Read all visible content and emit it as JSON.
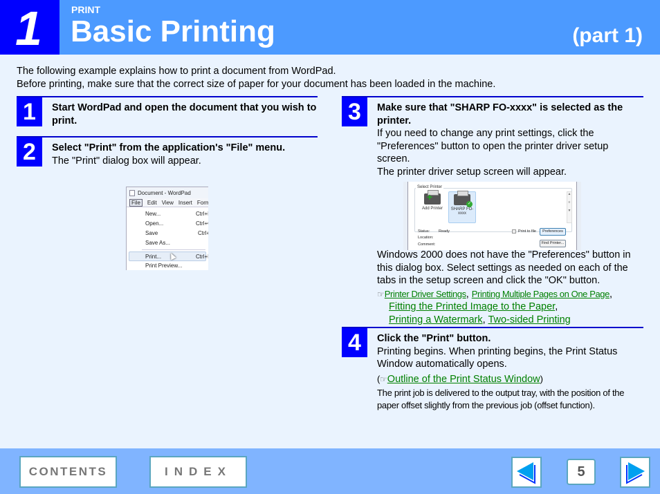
{
  "header": {
    "chapter_number": "1",
    "section_label": "PRINT",
    "title": "Basic Printing",
    "part": "(part 1)"
  },
  "intro": {
    "line1": "The following example explains how to print a document from WordPad.",
    "line2": "Before printing, make sure that the correct size of paper for your document has been loaded in the machine."
  },
  "steps": [
    {
      "number": "1",
      "title": "Start WordPad and open the document that you wish to print."
    },
    {
      "number": "2",
      "title": "Select \"Print\" from the application's \"File\" menu.",
      "text": "The \"Print\" dialog box will appear."
    },
    {
      "number": "3",
      "title": "Make sure that \"SHARP FO-xxxx\" is selected as the printer.",
      "text1": "If you need to change any print settings, click the \"Preferences\" button to open the printer driver setup screen.",
      "text2": "The printer driver setup screen will appear.",
      "text3": "Windows 2000 does not have the \"Preferences\" button in this dialog box. Select settings as needed on each of the tabs in the setup screen and click the \"OK\" button.",
      "ref_icon": "☞",
      "links": [
        "Printer Driver Settings",
        "Printing Multiple Pages on One Page",
        "Fitting the Printed Image to the Paper",
        "Printing a Watermark",
        "Two-sided Printing"
      ],
      "separators": {
        "comma": ","
      }
    },
    {
      "number": "4",
      "title": "Click the \"Print\" button.",
      "text1": "Printing begins. When printing begins, the Print Status Window automatically opens.",
      "ref_open": "(",
      "ref_icon": "☞",
      "link": "Outline of the Print Status Window",
      "ref_close": ")",
      "text2": "The print job is delivered to the output tray, with the position of the paper offset slightly from the previous job (offset function)."
    }
  ],
  "wordpad_screenshot": {
    "window_title": "Document - WordPad",
    "menubar": [
      "File",
      "Edit",
      "View",
      "Insert",
      "Form"
    ],
    "menu_items": [
      {
        "label": "New...",
        "shortcut": "Ctrl+N"
      },
      {
        "label": "Open...",
        "shortcut": "Ctrl+O"
      },
      {
        "label": "Save",
        "shortcut": "Ctrl+S"
      },
      {
        "label": "Save As...",
        "shortcut": ""
      },
      {
        "label": "Print...",
        "shortcut": "Ctrl+P"
      },
      {
        "label": "Print Preview...",
        "shortcut": ""
      }
    ]
  },
  "print_dialog_screenshot": {
    "group_label": "Select Printer",
    "printers": [
      "Add Printer",
      "SHARP FO-xxxx"
    ],
    "status_label": "Status:",
    "status_value": "Ready",
    "location_label": "Location:",
    "comment_label": "Comment:",
    "print_to_file": "Print to file",
    "preferences_button": "Preferences",
    "find_printer_button": "Find Printer..."
  },
  "footer": {
    "contents_label": "CONTENTS",
    "index_label": "INDEX",
    "page_number": "5",
    "prev_icon": "prev-arrow",
    "next_icon": "next-arrow"
  }
}
